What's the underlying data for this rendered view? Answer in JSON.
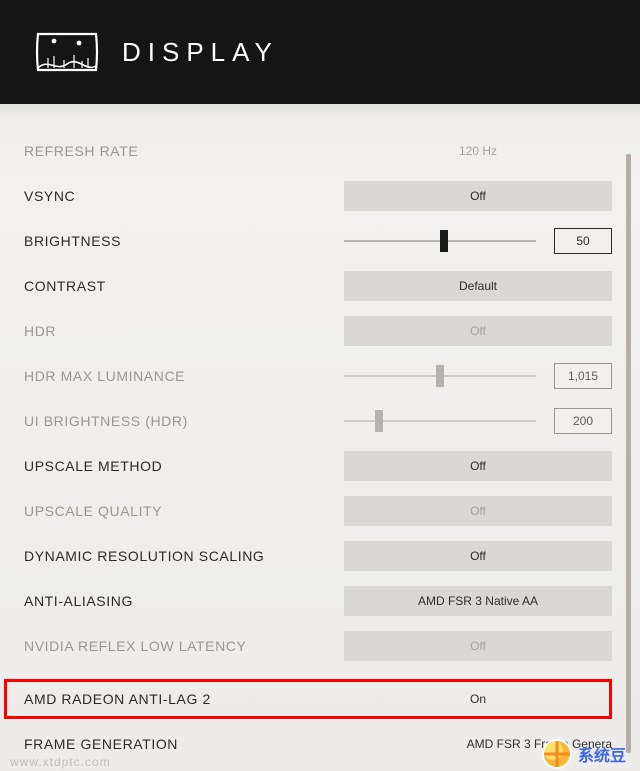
{
  "header": {
    "title": "DISPLAY"
  },
  "settings": {
    "refresh_rate": {
      "label": "REFRESH RATE",
      "value": "120 Hz"
    },
    "vsync": {
      "label": "VSYNC",
      "value": "Off"
    },
    "brightness": {
      "label": "BRIGHTNESS",
      "value": "50",
      "pos": 52
    },
    "contrast": {
      "label": "CONTRAST",
      "value": "Default"
    },
    "hdr": {
      "label": "HDR",
      "value": "Off"
    },
    "hdr_max_lum": {
      "label": "HDR MAX LUMINANCE",
      "value": "1,015",
      "pos": 50
    },
    "ui_brightness": {
      "label": "UI BRIGHTNESS (HDR)",
      "value": "200",
      "pos": 18
    },
    "upscale_method": {
      "label": "UPSCALE METHOD",
      "value": "Off"
    },
    "upscale_quality": {
      "label": "UPSCALE QUALITY",
      "value": "Off"
    },
    "dyn_res": {
      "label": "DYNAMIC RESOLUTION SCALING",
      "value": "Off"
    },
    "anti_aliasing": {
      "label": "ANTI-ALIASING",
      "value": "AMD FSR 3 Native AA"
    },
    "reflex": {
      "label": "NVIDIA REFLEX LOW LATENCY",
      "value": "Off"
    },
    "antilag2": {
      "label": "AMD RADEON ANTI-LAG 2",
      "value": "On"
    },
    "frame_gen": {
      "label": "FRAME GENERATION",
      "value": "AMD FSR 3 Frame Genera"
    }
  },
  "watermark": {
    "text": "系统豆",
    "url": "www.xtdptc.com"
  }
}
